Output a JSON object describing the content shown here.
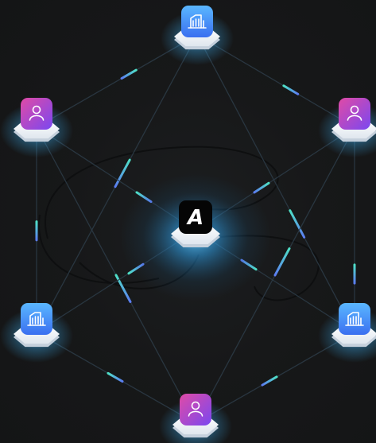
{
  "diagram": {
    "center": {
      "label": "A",
      "icon": "brand-logo-icon"
    },
    "nodes": [
      {
        "id": "top",
        "kind": "building",
        "icon": "building-icon",
        "color_top": "#5ab7ff",
        "color_bottom": "#3a6ff0"
      },
      {
        "id": "upper-left",
        "kind": "user",
        "icon": "user-icon",
        "color_top": "#e04aa6",
        "color_bottom": "#7a48f0"
      },
      {
        "id": "upper-right",
        "kind": "user",
        "icon": "user-icon",
        "color_top": "#e04aa6",
        "color_bottom": "#7a48f0"
      },
      {
        "id": "lower-left",
        "kind": "building",
        "icon": "building-icon",
        "color_top": "#5ab7ff",
        "color_bottom": "#3a6ff0"
      },
      {
        "id": "lower-right",
        "kind": "building",
        "icon": "building-icon",
        "color_top": "#5ab7ff",
        "color_bottom": "#3a6ff0"
      },
      {
        "id": "bottom",
        "kind": "user",
        "icon": "user-icon",
        "color_top": "#e04aa6",
        "color_bottom": "#7a48f0"
      }
    ],
    "links": [
      [
        "top",
        "upper-left"
      ],
      [
        "top",
        "upper-right"
      ],
      [
        "top",
        "lower-left"
      ],
      [
        "top",
        "lower-right"
      ],
      [
        "upper-left",
        "lower-left"
      ],
      [
        "upper-left",
        "center"
      ],
      [
        "upper-left",
        "bottom"
      ],
      [
        "upper-right",
        "lower-right"
      ],
      [
        "upper-right",
        "center"
      ],
      [
        "upper-right",
        "bottom"
      ],
      [
        "lower-left",
        "center"
      ],
      [
        "lower-left",
        "bottom"
      ],
      [
        "lower-right",
        "center"
      ],
      [
        "lower-right",
        "bottom"
      ]
    ],
    "colors": {
      "background": "#161718",
      "line": "#2b3a45",
      "dash_start": "#4ee0c6",
      "dash_end": "#5b7cf0",
      "glow": "#3fb9ff",
      "platform": "#f2f6fa"
    }
  }
}
